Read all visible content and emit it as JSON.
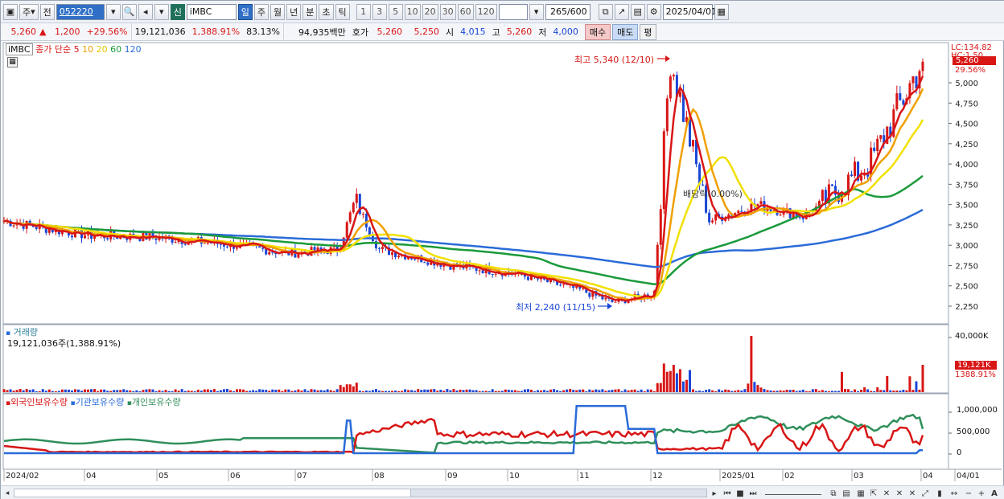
{
  "toolbar": {
    "period_selector": "주",
    "prev_label": "전",
    "stock_code": "052220",
    "new_badge": "신",
    "stock_name": "iMBC",
    "periods": [
      "일",
      "주",
      "월",
      "년",
      "분",
      "초",
      "틱"
    ],
    "active_period": "일",
    "intervals": [
      "1",
      "3",
      "5",
      "10",
      "20",
      "30",
      "60",
      "120"
    ],
    "count_value": "265",
    "count_total": "/600",
    "date_value": "2025/04/01"
  },
  "quote": {
    "price": "5,260",
    "change_arrow": "▲",
    "change": "1,200",
    "change_pct": "+29.56%",
    "volume": "19,121,036",
    "volume_ratio": "1,388.91%",
    "turnover": "83.13%",
    "amount": "94,935백만",
    "bid_label": "호가",
    "ask_price": "5,260",
    "bid_price": "5,250",
    "open_label": "시",
    "open_value": "4,015",
    "high_label": "고",
    "high_value": "5,260",
    "low_label": "저",
    "low_value": "4,000",
    "buy_label": "매수",
    "sell_label": "매도",
    "eval_label": "평"
  },
  "price_panel": {
    "legend_name": "iMBC",
    "legend_ma_label": "종가 단순",
    "ma_periods": [
      {
        "label": "5",
        "color": "#d81616"
      },
      {
        "label": "10",
        "color": "#f0a000"
      },
      {
        "label": "20",
        "color": "#f2e000"
      },
      {
        "label": "60",
        "color": "#1a9a3a"
      },
      {
        "label": "120",
        "color": "#2a6bd8"
      }
    ],
    "axis_top_label": "LC:134.82",
    "axis_top_label2": "HC:1.50",
    "current_price_badge": "5,260",
    "current_pct": "29.56%",
    "high_annotation": "최고 5,340 (12/10)",
    "low_annotation": "최저 2,240 (11/15)",
    "ex_rights_annotation": "배당락(0.00%)",
    "y_ticks": [
      "5,000",
      "4,750",
      "4,500",
      "4,250",
      "4,000",
      "3,750",
      "3,500",
      "3,250",
      "3,000",
      "2,750",
      "2,500",
      "2,250"
    ]
  },
  "volume_panel": {
    "title": "거래량",
    "value_text": "19,121,036주(1,388.91%)",
    "y_ticks": [
      "40,000K"
    ],
    "current_badge": "19,121K",
    "current_pct": "1388.91%"
  },
  "holding_panel": {
    "series": [
      {
        "name": "외국인보유수량",
        "color": "#d81616"
      },
      {
        "name": "기관보유수량",
        "color": "#2a6bd8"
      },
      {
        "name": "개인보유수량",
        "color": "#2f8f5a"
      }
    ],
    "y_ticks": [
      "1,000,000",
      "500,000",
      "0"
    ]
  },
  "x_axis": {
    "labels": [
      "2024/02",
      "04",
      "05",
      "06",
      "07",
      "08",
      "09",
      "10",
      "11",
      "12",
      "2025/01",
      "02",
      "03",
      "04",
      "04/01"
    ]
  },
  "colors": {
    "up": "#d81616",
    "down": "#1b46d6",
    "ma5": "#d81616",
    "ma10": "#f0a000",
    "ma20": "#f2e000",
    "ma60": "#1a9a3a",
    "ma120": "#2a6bd8"
  },
  "chart_data": {
    "type": "line",
    "title": "",
    "price_series": {
      "x": [
        "2024/02",
        "2024/03",
        "2024/04",
        "2024/05",
        "2024/06",
        "2024/07",
        "2024/07/25",
        "2024/08",
        "2024/08/10",
        "2024/09",
        "2024/10",
        "2024/11",
        "2024/11/15",
        "2024/12",
        "2024/12/10",
        "2024/12/20",
        "2025/01",
        "2025/02",
        "2025/03",
        "2025/04/01"
      ],
      "close": [
        3300,
        3200,
        3120,
        3100,
        3000,
        2900,
        2950,
        3550,
        2950,
        2750,
        2650,
        2450,
        2300,
        2400,
        5340,
        3300,
        3500,
        3350,
        4000,
        5260
      ]
    },
    "ylim": [
      2200,
      5350
    ]
  }
}
